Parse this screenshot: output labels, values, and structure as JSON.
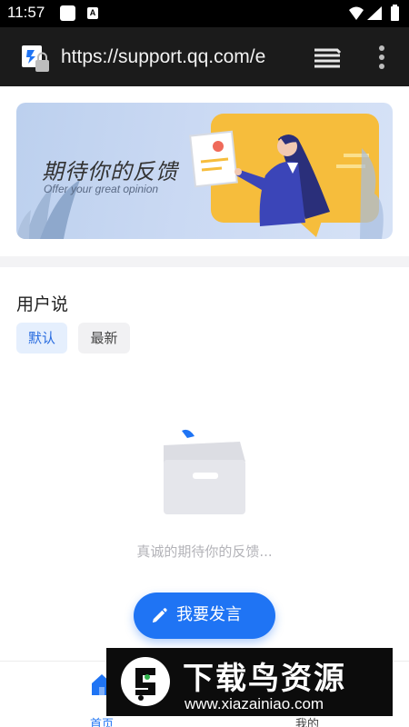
{
  "status_bar": {
    "time": "11:57",
    "notif_badge": "A",
    "icons": [
      "wifi-icon",
      "signal-icon",
      "battery-icon"
    ]
  },
  "browser": {
    "url": "https://support.qq.com/e",
    "icons": [
      "site-lock-icon",
      "tabs-icon",
      "overflow-menu-icon"
    ]
  },
  "banner": {
    "title": "期待你的反馈",
    "subtitle": "Offer your great opinion"
  },
  "section": {
    "title": "用户说"
  },
  "filters": {
    "default_label": "默认",
    "latest_label": "最新",
    "active": "默认"
  },
  "empty_state": {
    "text": "真诚的期待你的反馈..."
  },
  "fab": {
    "label": "我要发言",
    "icon": "pencil-icon"
  },
  "bottom_nav": {
    "home_label": "首页",
    "mine_label": "我的"
  },
  "watermark": {
    "title": "下载鸟资源",
    "url": "www.xiazainiao.com"
  },
  "colors": {
    "accent": "#1f74f4",
    "toolbar": "#1b1b1b",
    "banner_bg": "#c8d8f2",
    "banner_card": "#f6bd3c"
  }
}
